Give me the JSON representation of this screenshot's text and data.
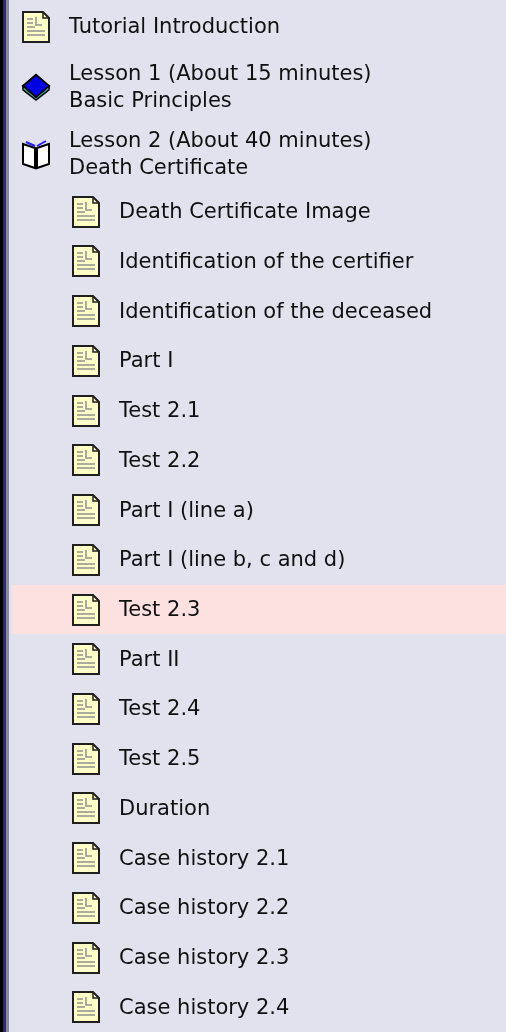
{
  "tree": [
    {
      "kind": "page",
      "title": "Tutorial Introduction",
      "selected": false
    },
    {
      "kind": "book",
      "title": "Lesson 1 (About 15 minutes)",
      "subtitle": "Basic Principles",
      "selected": false
    },
    {
      "kind": "open-book",
      "title": "Lesson 2 (About 40 minutes)",
      "subtitle": "Death Certificate",
      "selected": false,
      "children": [
        {
          "kind": "page",
          "title": "Death Certificate Image",
          "selected": false
        },
        {
          "kind": "page",
          "title": "Identification of the certifier",
          "selected": false
        },
        {
          "kind": "page",
          "title": "Identification of the deceased",
          "selected": false
        },
        {
          "kind": "page",
          "title": "Part I",
          "selected": false
        },
        {
          "kind": "page",
          "title": "Test 2.1",
          "selected": false
        },
        {
          "kind": "page",
          "title": "Test 2.2",
          "selected": false
        },
        {
          "kind": "page",
          "title": "Part I (line a)",
          "selected": false
        },
        {
          "kind": "page",
          "title": "Part I (line b, c and d)",
          "selected": false
        },
        {
          "kind": "page",
          "title": "Test 2.3",
          "selected": true
        },
        {
          "kind": "page",
          "title": "Part II",
          "selected": false
        },
        {
          "kind": "page",
          "title": "Test 2.4",
          "selected": false
        },
        {
          "kind": "page",
          "title": "Test 2.5",
          "selected": false
        },
        {
          "kind": "page",
          "title": "Duration",
          "selected": false
        },
        {
          "kind": "page",
          "title": "Case history 2.1",
          "selected": false
        },
        {
          "kind": "page",
          "title": "Case history 2.2",
          "selected": false
        },
        {
          "kind": "page",
          "title": "Case history 2.3",
          "selected": false
        },
        {
          "kind": "page",
          "title": "Case history 2.4",
          "selected": false
        }
      ]
    }
  ]
}
